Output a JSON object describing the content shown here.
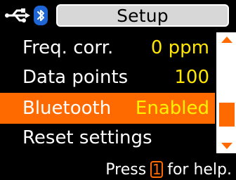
{
  "header": {
    "title": "Setup",
    "icons": {
      "usb": "usb-icon",
      "bluetooth": "bluetooth-icon"
    },
    "colors": {
      "bluetooth_bg": "#1e66d6",
      "title_bg": "#d7d7d7"
    }
  },
  "menu": {
    "items": [
      {
        "label": "Freq. corr.",
        "value": "0 ppm"
      },
      {
        "label": "Data points",
        "value": "100"
      },
      {
        "label": "Bluetooth",
        "value": "Enabled",
        "selected": true
      },
      {
        "label": "Reset settings",
        "value": ""
      }
    ],
    "colors": {
      "value": "#ffe600",
      "selected_bg": "#ff6a00"
    }
  },
  "scrollbar": {
    "up_icon": "up-arrow-icon",
    "down_icon": "down-arrow-icon"
  },
  "footer": {
    "help_prefix": "Press",
    "help_key": "1",
    "help_suffix": "for help."
  }
}
